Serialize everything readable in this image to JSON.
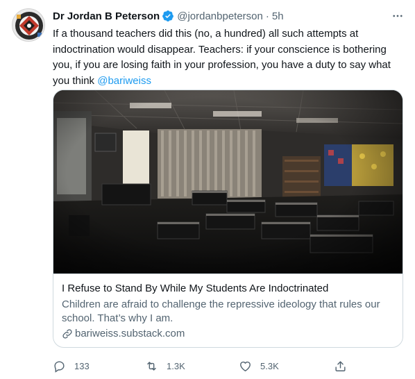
{
  "tweet": {
    "author_name": "Dr Jordan B Peterson",
    "handle": "@jordanbpeterson",
    "separator": "·",
    "time": "5h",
    "text_main": "If a thousand teachers did this (no, a hundred) all such attempts at indoctrination would disappear. Teachers: if your conscience is bothering you, if you are losing faith in your profession, you have a duty to say what you think ",
    "mention": "@bariweiss"
  },
  "card": {
    "image_description_icon": "classroom-photo",
    "title": "I Refuse to Stand By While My Students Are Indoctrinated",
    "description": "Children are afraid to challenge the repressive ideology that rules our school. That’s why I am.",
    "domain": "bariweiss.substack.com"
  },
  "actions": {
    "reply_count": "133",
    "retweet_count": "1.3K",
    "like_count": "5.3K"
  },
  "colors": {
    "link": "#1d9bf0",
    "secondary_text": "#536471",
    "border": "#cfd9de"
  },
  "icons": [
    "verified-badge-icon",
    "more-icon",
    "link-icon",
    "reply-icon",
    "retweet-icon",
    "like-icon",
    "share-icon"
  ]
}
